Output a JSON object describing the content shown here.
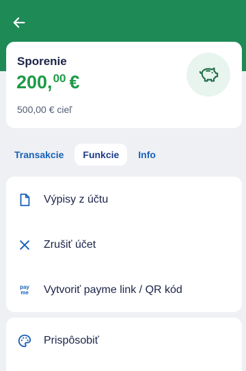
{
  "header": {
    "back_icon": "arrow-left-icon"
  },
  "account": {
    "name": "Sporenie",
    "balance_whole": "200,",
    "balance_cents": "00",
    "balance_currency": "€",
    "goal_text": "500,00 € cieľ",
    "icon": "piggy-bank-icon"
  },
  "tabs": [
    {
      "label": "Transakcie",
      "active": false
    },
    {
      "label": "Funkcie",
      "active": true
    },
    {
      "label": "Info",
      "active": false
    }
  ],
  "functions": {
    "items": [
      {
        "label": "Výpisy z účtu",
        "icon": "document-icon"
      },
      {
        "label": "Zrušiť účet",
        "icon": "close-icon"
      },
      {
        "label": "Vytvoriť payme link / QR kód",
        "icon": "payme-icon",
        "icon_text_top": "pay",
        "icon_text_bottom": "me"
      }
    ],
    "extra": {
      "label": "Prispôsobiť",
      "icon": "palette-icon"
    }
  },
  "colors": {
    "brand": "#1e8a56",
    "amount": "#1c9b46",
    "link": "#1860b8",
    "background": "#eef0f4"
  }
}
